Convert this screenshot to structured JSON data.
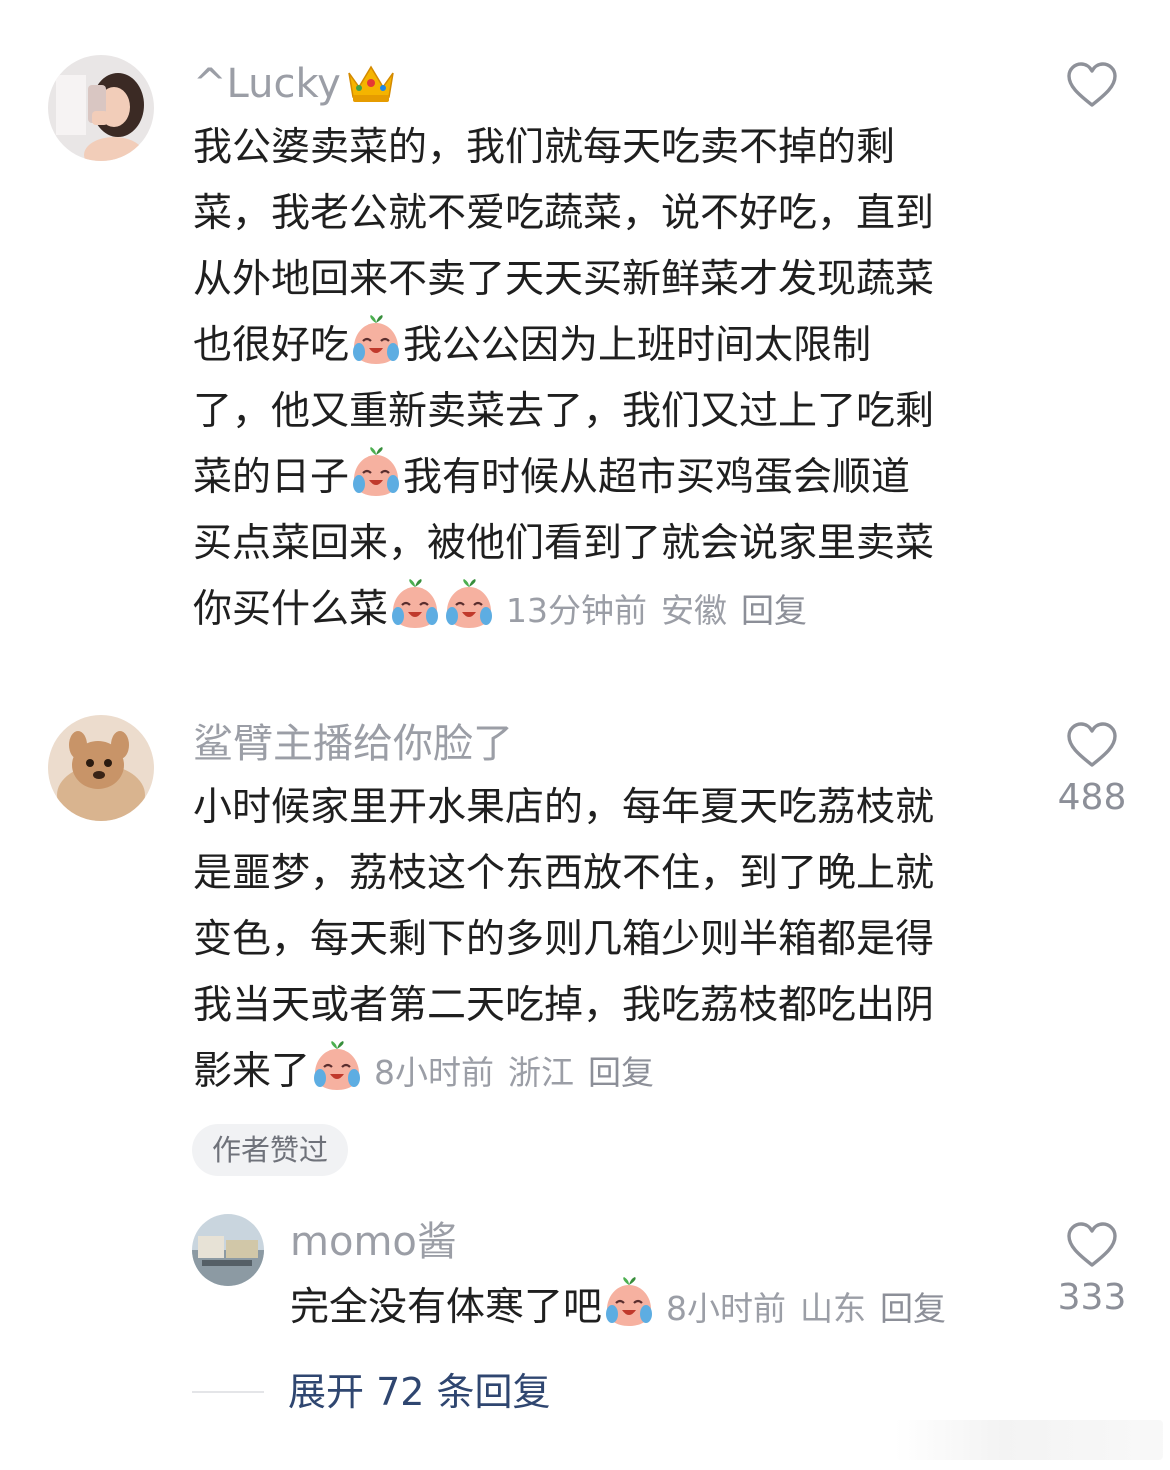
{
  "comments": [
    {
      "username": "^Lucky",
      "username_badge_icon": "crown-icon",
      "lines": [
        "我公婆卖菜的，我们就每天吃卖不掉的剩",
        "菜，我老公就不爱吃蔬菜，说不好吃，直到",
        "从外地回来不卖了天天买新鲜菜才发现蔬菜",
        "也很好吃",
        "我公公因为上班时间太限制",
        "了，他又重新卖菜去了，我们又过上了吃剩",
        "菜的日子",
        "我有时候从超市买鸡蛋会顺道",
        "买点菜回来，被他们看到了就会说家里卖菜",
        "你买什么菜"
      ],
      "time": "13分钟前",
      "location": "安徽",
      "reply_label": "回复",
      "like_count": ""
    },
    {
      "username": "鲨臂主播给你脸了",
      "lines": [
        "小时候家里开水果店的，每年夏天吃荔枝就",
        "是噩梦，荔枝这个东西放不住，到了晚上就",
        "变色，每天剩下的多则几箱少则半箱都是得",
        "我当天或者第二天吃掉，我吃荔枝都吃出阴",
        "影来了"
      ],
      "time": "8小时前",
      "location": "浙江",
      "reply_label": "回复",
      "like_count": "488",
      "badge": "作者赞过"
    }
  ],
  "reply": {
    "username": "momo酱",
    "text": "完全没有体寒了吧",
    "time": "8小时前",
    "location": "山东",
    "reply_label": "回复",
    "like_count": "333"
  },
  "expand": {
    "label": "展开 72 条回复"
  },
  "icons": {
    "like": "heart-outline-icon",
    "emoji": "crying-peach-emoji-icon"
  },
  "colors": {
    "text": "#1f1f1f",
    "muted": "#9b9ea6",
    "link": "#2f4670"
  }
}
